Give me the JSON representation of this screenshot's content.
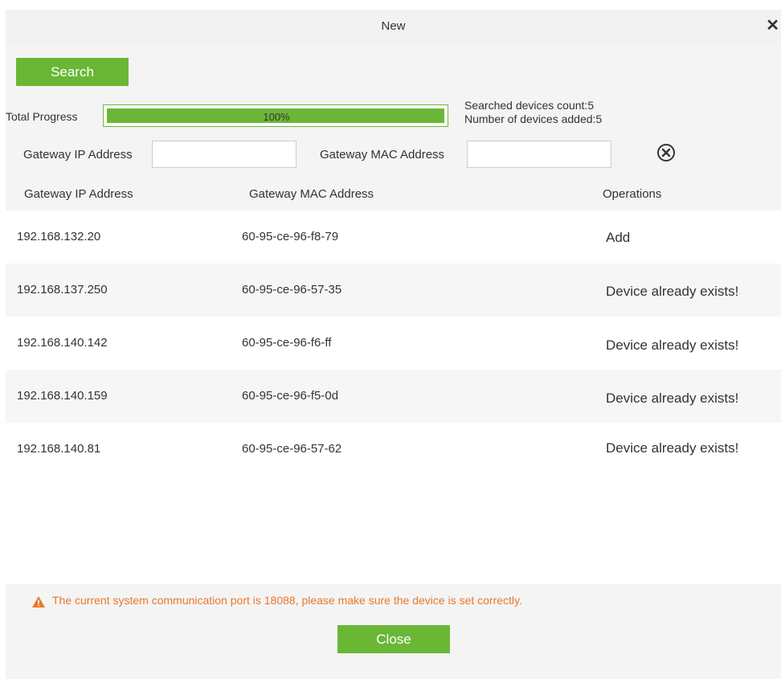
{
  "dialog": {
    "title": "New"
  },
  "toolbar": {
    "search_label": "Search"
  },
  "progress": {
    "label": "Total Progress",
    "value_text": "100%",
    "fraction": 1.0,
    "searched_count": "Searched devices count:5",
    "added_count": "Number of devices added:5"
  },
  "filters": {
    "ip_label": "Gateway IP Address",
    "ip_value": "",
    "mac_label": "Gateway MAC Address",
    "mac_value": ""
  },
  "table": {
    "columns": [
      "Gateway IP Address",
      "Gateway MAC Address",
      "Operations"
    ],
    "rows": [
      {
        "ip": "192.168.132.20",
        "mac": "60-95-ce-96-f8-79",
        "op": "Add"
      },
      {
        "ip": "192.168.137.250",
        "mac": "60-95-ce-96-57-35",
        "op": "Device already exists!"
      },
      {
        "ip": "192.168.140.142",
        "mac": "60-95-ce-96-f6-ff",
        "op": "Device already exists!"
      },
      {
        "ip": "192.168.140.159",
        "mac": "60-95-ce-96-f5-0d",
        "op": "Device already exists!"
      },
      {
        "ip": "192.168.140.81",
        "mac": "60-95-ce-96-57-62",
        "op": "Device already exists!"
      }
    ]
  },
  "footer": {
    "warning": "The current system communication port is 18088, please make sure the device is set correctly.",
    "close_label": "Close"
  },
  "colors": {
    "accent": "#6ab736",
    "warning": "#e8782a"
  }
}
